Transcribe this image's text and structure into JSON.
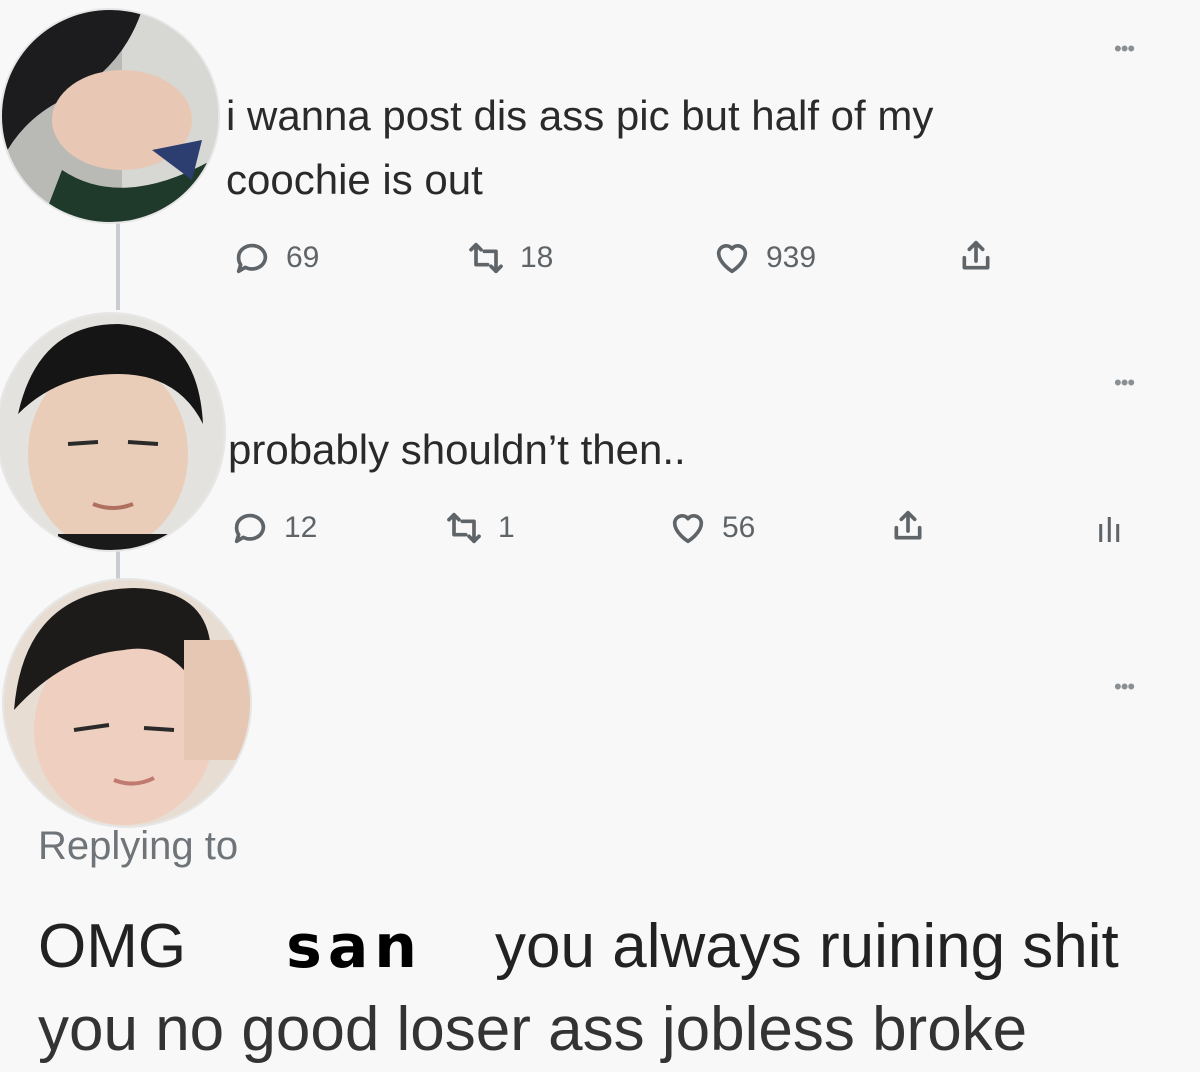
{
  "tweets": [
    {
      "text": "i wanna post dis ass pic but half of my coochie is out",
      "more": "•••",
      "replies": "69",
      "retweets": "18",
      "likes": "939"
    },
    {
      "text": "probably shouldn’t then..",
      "more": "•••",
      "replies": "12",
      "retweets": "1",
      "likes": "56",
      "analytics": "ılı"
    },
    {
      "more": "•••",
      "replying_label": "Replying to",
      "reply_start": "OMG",
      "reply_name": "san",
      "reply_end": "you always ruining shit",
      "reply_continued": "you no good loser ass jobless broke"
    }
  ],
  "colors": {
    "background": "#f8f8f8",
    "thread_line": "#c9cdd1",
    "icon": "#5f6468"
  },
  "icons": [
    "reply-icon",
    "retweet-icon",
    "heart-icon",
    "share-icon",
    "analytics-icon"
  ]
}
